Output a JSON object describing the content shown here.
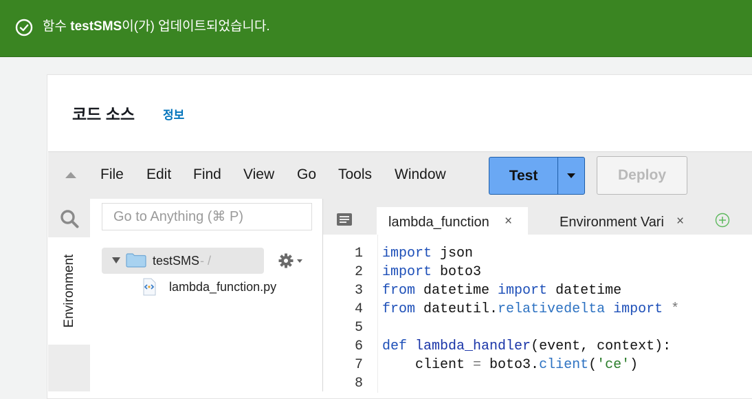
{
  "banner": {
    "prefix": "함수 ",
    "function_name": "testSMS",
    "suffix": "이(가) 업데이트되었습니다.",
    "color": "#3a8522"
  },
  "section": {
    "title": "코드 소스",
    "info_link": "정보"
  },
  "menu": {
    "items": [
      "File",
      "Edit",
      "Find",
      "View",
      "Go",
      "Tools",
      "Window"
    ],
    "test_label": "Test",
    "deploy_label": "Deploy"
  },
  "sidebar": {
    "goto_placeholder": "Go to Anything (⌘ P)",
    "env_tab_label": "Environment",
    "root_folder": "testSMS",
    "root_path": " - /",
    "file": "lambda_function.py"
  },
  "tabs": [
    {
      "label": "lambda_function",
      "close": "×",
      "active": true
    },
    {
      "label": "Environment Vari",
      "close": "×",
      "active": false
    }
  ],
  "editor": {
    "line_numbers": [
      "1",
      "2",
      "3",
      "4",
      "5",
      "6",
      "7",
      "8"
    ],
    "lines": [
      [
        {
          "t": "import",
          "c": "kw"
        },
        {
          "t": " json",
          "c": ""
        }
      ],
      [
        {
          "t": "import",
          "c": "kw"
        },
        {
          "t": " boto3",
          "c": ""
        }
      ],
      [
        {
          "t": "from",
          "c": "kw"
        },
        {
          "t": " datetime ",
          "c": ""
        },
        {
          "t": "import",
          "c": "kw"
        },
        {
          "t": " datetime",
          "c": ""
        }
      ],
      [
        {
          "t": "from",
          "c": "kw"
        },
        {
          "t": " dateutil.",
          "c": ""
        },
        {
          "t": "relativedelta",
          "c": "attr"
        },
        {
          "t": " ",
          "c": ""
        },
        {
          "t": "import",
          "c": "kw"
        },
        {
          "t": " *",
          "c": "op"
        }
      ],
      [],
      [
        {
          "t": "def",
          "c": "kw"
        },
        {
          "t": " ",
          "c": ""
        },
        {
          "t": "lambda_handler",
          "c": "fn"
        },
        {
          "t": "(event, context):",
          "c": ""
        }
      ],
      [
        {
          "t": "    client ",
          "c": ""
        },
        {
          "t": "=",
          "c": "op"
        },
        {
          "t": " boto3.",
          "c": ""
        },
        {
          "t": "client",
          "c": "attr"
        },
        {
          "t": "(",
          "c": ""
        },
        {
          "t": "'ce'",
          "c": "str"
        },
        {
          "t": ")",
          "c": ""
        }
      ],
      []
    ]
  },
  "icons": {
    "banner": "check-circle-icon",
    "search": "search-icon",
    "folder": "folder-icon",
    "gear": "gear-icon",
    "file": "python-file-icon",
    "tabs_menu": "tabs-menu-icon",
    "add_tab": "add-tab-icon"
  }
}
